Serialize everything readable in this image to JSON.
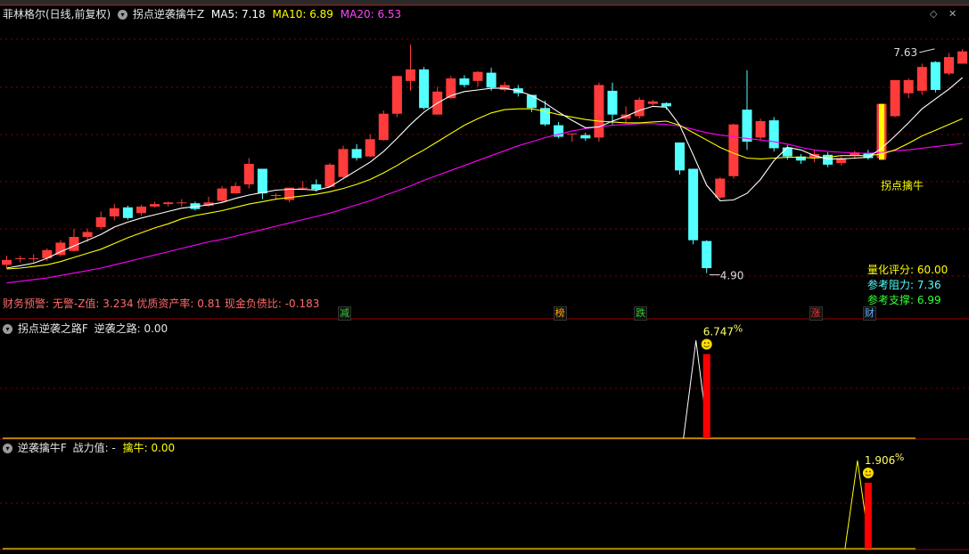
{
  "colors": {
    "up": "#ff3b3b",
    "down": "#54ffff",
    "ma5": "#ffffff",
    "ma10": "#ffff00",
    "ma20": "#ff00ff",
    "panel_border": "#a00000",
    "grid": "#8a0000",
    "highlight": "#ffff00"
  },
  "main_panel": {
    "stock_title": "菲林格尔(日线,前复权)",
    "indicator_name": "拐点逆袭擒牛Z",
    "ma5": "MA5: 7.18",
    "ma10": "MA10: 6.89",
    "ma20": "MA20: 6.53",
    "high_label": "7.63",
    "low_label": "4.90",
    "signal_label": "拐点擒牛",
    "finance_text": "财务预警: 无警-Z值: 3.234 优质资产率: 0.81 现金负债比: -0.183",
    "rating": [
      {
        "label": "量化评分:",
        "value": "60.00"
      },
      {
        "label": "参考阻力:",
        "value": "7.36"
      },
      {
        "label": "参考支撑:",
        "value": "6.99"
      }
    ],
    "event_tags": [
      {
        "text": "减",
        "bar": 25,
        "color": "#33cc33"
      },
      {
        "text": "榜",
        "bar": 41,
        "color": "#ffaa00"
      },
      {
        "text": "跌",
        "bar": 47,
        "color": "#33cc33"
      },
      {
        "text": "涨",
        "bar": 60,
        "color": "#ff3333"
      },
      {
        "text": "财",
        "bar": 64,
        "color": "#66aaff"
      }
    ]
  },
  "sub_panel_1": {
    "title": "拐点逆袭之路F",
    "label": "逆袭之路:",
    "value": "0.00",
    "pct": "6.747",
    "pct_sign": "%"
  },
  "sub_panel_2": {
    "title": "逆袭擒牛F",
    "label": "战力值: -",
    "label2": "擒牛:",
    "value": "0.00",
    "pct": "1.906",
    "pct_sign": "%"
  },
  "chart_data": {
    "type": "candlestick",
    "price_range": [
      4.7,
      7.9
    ],
    "candles": [
      [
        5.0,
        5.06,
        4.96,
        5.11
      ],
      [
        5.07,
        5.08,
        5.03,
        5.11
      ],
      [
        5.08,
        5.08,
        5.03,
        5.13
      ],
      [
        5.08,
        5.18,
        5.05,
        5.2
      ],
      [
        5.12,
        5.27,
        5.1,
        5.3
      ],
      [
        5.17,
        5.34,
        5.16,
        5.44
      ],
      [
        5.34,
        5.4,
        5.28,
        5.44
      ],
      [
        5.46,
        5.58,
        5.43,
        5.65
      ],
      [
        5.59,
        5.69,
        5.54,
        5.74
      ],
      [
        5.7,
        5.57,
        5.55,
        5.72
      ],
      [
        5.63,
        5.71,
        5.6,
        5.73
      ],
      [
        5.71,
        5.74,
        5.7,
        5.77
      ],
      [
        5.74,
        5.76,
        5.71,
        5.77
      ],
      [
        5.75,
        5.76,
        5.71,
        5.8
      ],
      [
        5.75,
        5.68,
        5.66,
        5.77
      ],
      [
        5.72,
        5.76,
        5.71,
        5.83
      ],
      [
        5.78,
        5.93,
        5.76,
        5.96
      ],
      [
        5.87,
        5.96,
        5.87,
        6.0
      ],
      [
        5.98,
        6.23,
        5.93,
        6.3
      ],
      [
        6.17,
        5.87,
        5.8,
        6.17
      ],
      [
        5.85,
        5.85,
        5.8,
        5.87
      ],
      [
        5.79,
        5.94,
        5.76,
        5.94
      ],
      [
        5.94,
        5.94,
        5.92,
        6.02
      ],
      [
        5.98,
        5.92,
        5.89,
        6.04
      ],
      [
        5.95,
        6.22,
        5.94,
        6.24
      ],
      [
        6.07,
        6.41,
        6.06,
        6.45
      ],
      [
        6.41,
        6.3,
        6.27,
        6.47
      ],
      [
        6.32,
        6.53,
        6.31,
        6.59
      ],
      [
        6.52,
        6.84,
        6.51,
        6.88
      ],
      [
        6.84,
        7.3,
        6.8,
        7.3
      ],
      [
        7.24,
        7.38,
        7.12,
        7.68
      ],
      [
        7.38,
        6.91,
        6.89,
        7.41
      ],
      [
        6.83,
        7.11,
        6.86,
        7.17
      ],
      [
        7.03,
        7.27,
        7.02,
        7.3
      ],
      [
        7.27,
        7.19,
        7.16,
        7.31
      ],
      [
        7.24,
        7.35,
        7.17,
        7.36
      ],
      [
        7.34,
        7.16,
        7.12,
        7.4
      ],
      [
        7.13,
        7.19,
        7.11,
        7.23
      ],
      [
        7.15,
        7.09,
        7.05,
        7.19
      ],
      [
        7.07,
        6.91,
        6.86,
        7.06
      ],
      [
        6.91,
        6.71,
        6.69,
        7.0
      ],
      [
        6.7,
        6.56,
        6.54,
        6.74
      ],
      [
        6.6,
        6.6,
        6.5,
        6.6
      ],
      [
        6.58,
        6.54,
        6.51,
        6.61
      ],
      [
        6.55,
        7.19,
        6.5,
        7.22
      ],
      [
        7.12,
        6.83,
        6.71,
        7.22
      ],
      [
        6.78,
        6.83,
        6.73,
        6.93
      ],
      [
        6.81,
        7.01,
        6.78,
        7.04
      ],
      [
        6.96,
        6.99,
        6.94,
        7.01
      ],
      [
        6.97,
        6.93,
        6.89,
        6.98
      ],
      [
        6.49,
        6.15,
        6.1,
        6.49
      ],
      [
        6.17,
        5.3,
        5.25,
        6.17
      ],
      [
        5.29,
        4.96,
        4.9,
        5.3
      ],
      [
        5.82,
        6.05,
        5.8,
        6.07
      ],
      [
        6.08,
        6.71,
        6.05,
        6.72
      ],
      [
        6.89,
        6.5,
        6.4,
        7.37
      ],
      [
        6.55,
        6.75,
        6.52,
        6.78
      ],
      [
        6.76,
        6.42,
        6.38,
        6.8
      ],
      [
        6.43,
        6.32,
        6.28,
        6.46
      ],
      [
        6.32,
        6.27,
        6.23,
        6.35
      ],
      [
        6.3,
        6.35,
        6.25,
        6.4
      ],
      [
        6.34,
        6.22,
        6.19,
        6.37
      ],
      [
        6.24,
        6.3,
        6.21,
        6.32
      ],
      [
        6.33,
        6.37,
        6.29,
        6.39
      ],
      [
        6.36,
        6.3,
        6.28,
        6.4
      ],
      [
        6.3,
        6.96,
        6.28,
        6.96
      ],
      [
        6.81,
        7.25,
        6.8,
        7.25
      ],
      [
        7.09,
        7.25,
        7.03,
        7.27
      ],
      [
        7.12,
        7.41,
        7.07,
        7.45
      ],
      [
        7.47,
        7.13,
        7.1,
        7.48
      ],
      [
        7.33,
        7.53,
        7.31,
        7.58
      ],
      [
        7.45,
        7.6,
        7.45,
        7.63
      ]
    ],
    "ma5": [
      4.96,
      4.99,
      5.02,
      5.08,
      5.16,
      5.23,
      5.3,
      5.37,
      5.46,
      5.52,
      5.57,
      5.61,
      5.65,
      5.69,
      5.71,
      5.73,
      5.76,
      5.81,
      5.85,
      5.88,
      5.91,
      5.92,
      5.92,
      5.91,
      5.95,
      6.05,
      6.15,
      6.25,
      6.38,
      6.54,
      6.71,
      6.86,
      6.97,
      7.06,
      7.11,
      7.13,
      7.15,
      7.15,
      7.12,
      7.06,
      6.97,
      6.86,
      6.76,
      6.67,
      6.68,
      6.75,
      6.81,
      6.88,
      6.93,
      6.92,
      6.7,
      6.34,
      5.97,
      5.78,
      5.79,
      5.87,
      6.04,
      6.27,
      6.43,
      6.4,
      6.33,
      6.29,
      6.29,
      6.3,
      6.31,
      6.42,
      6.57,
      6.73,
      6.9,
      7.02,
      7.14,
      7.28
    ],
    "ma10": [
      4.95,
      4.96,
      4.98,
      5.0,
      5.04,
      5.09,
      5.14,
      5.19,
      5.26,
      5.33,
      5.39,
      5.45,
      5.5,
      5.56,
      5.6,
      5.63,
      5.66,
      5.7,
      5.74,
      5.77,
      5.8,
      5.82,
      5.84,
      5.86,
      5.89,
      5.93,
      5.98,
      6.04,
      6.12,
      6.21,
      6.31,
      6.4,
      6.5,
      6.6,
      6.7,
      6.78,
      6.85,
      6.89,
      6.9,
      6.9,
      6.87,
      6.83,
      6.8,
      6.77,
      6.75,
      6.74,
      6.73,
      6.73,
      6.74,
      6.75,
      6.7,
      6.61,
      6.52,
      6.43,
      6.36,
      6.3,
      6.29,
      6.3,
      6.31,
      6.31,
      6.3,
      6.31,
      6.33,
      6.33,
      6.33,
      6.35,
      6.4,
      6.48,
      6.57,
      6.64,
      6.71,
      6.78
    ],
    "ma20": [
      4.78,
      4.8,
      4.82,
      4.84,
      4.87,
      4.9,
      4.93,
      4.96,
      5.0,
      5.04,
      5.08,
      5.12,
      5.16,
      5.2,
      5.24,
      5.28,
      5.31,
      5.35,
      5.39,
      5.43,
      5.47,
      5.51,
      5.55,
      5.59,
      5.63,
      5.68,
      5.73,
      5.78,
      5.84,
      5.9,
      5.96,
      6.03,
      6.09,
      6.15,
      6.21,
      6.27,
      6.33,
      6.39,
      6.45,
      6.5,
      6.55,
      6.59,
      6.63,
      6.66,
      6.68,
      6.7,
      6.71,
      6.72,
      6.72,
      6.71,
      6.69,
      6.65,
      6.61,
      6.58,
      6.56,
      6.54,
      6.52,
      6.5,
      6.47,
      6.43,
      6.4,
      6.38,
      6.37,
      6.36,
      6.36,
      6.37,
      6.39,
      6.4,
      6.42,
      6.44,
      6.46,
      6.48
    ],
    "signal_bar": 65,
    "sub1": {
      "spike_bar": 52,
      "ylim": [
        0,
        8
      ],
      "value": 6.747
    },
    "sub2": {
      "spike_bar": 64,
      "ylim": [
        0,
        2.6
      ],
      "value": 1.906
    }
  }
}
